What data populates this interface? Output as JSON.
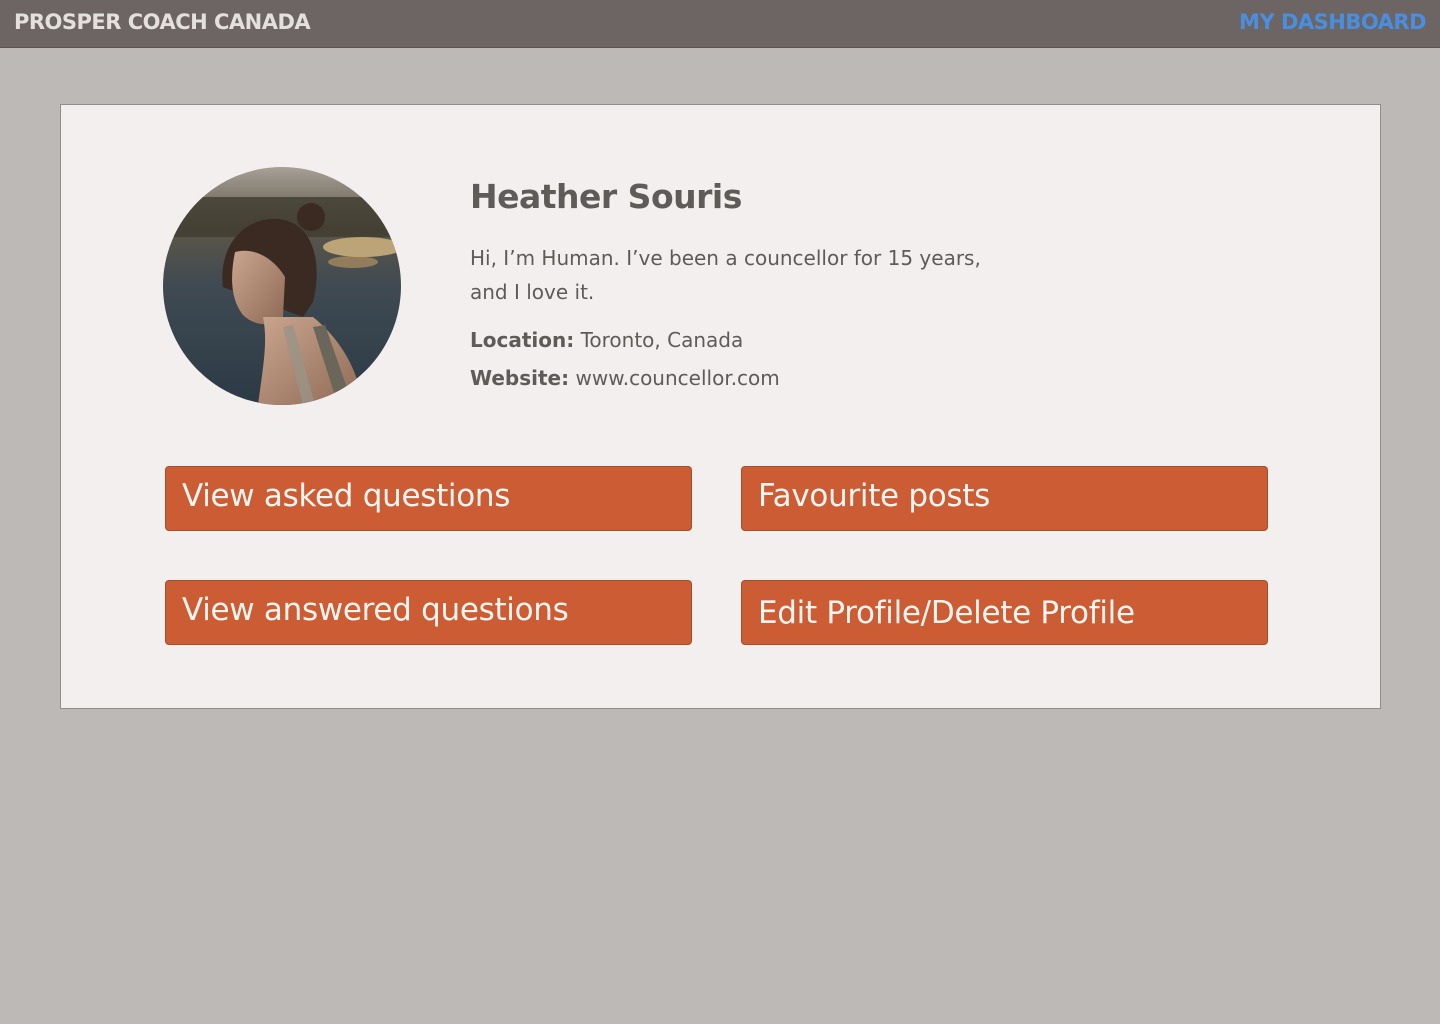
{
  "header": {
    "brand": "PROSPER COACH CANADA",
    "dashboard_link": "MY DASHBOARD"
  },
  "profile": {
    "name": "Heather Souris",
    "bio": "Hi, I’m Human. I’ve been a councellor for 15 years, and I love it.",
    "location_label": "Location:",
    "location_value": "Toronto, Canada",
    "website_label": "Website:",
    "website_value": "www.councellor.com"
  },
  "actions": {
    "view_asked": "View asked questions",
    "favourite_posts": "Favourite posts",
    "view_answered": "View answered questions",
    "edit_delete_profile": "Edit Profile/Delete Profile"
  },
  "colors": {
    "page_background": "#bdb9b6",
    "header_background": "#6d6464",
    "link_accent": "#4a8ee0",
    "card_background": "#f2efee",
    "button_color": "#cc5c34"
  }
}
